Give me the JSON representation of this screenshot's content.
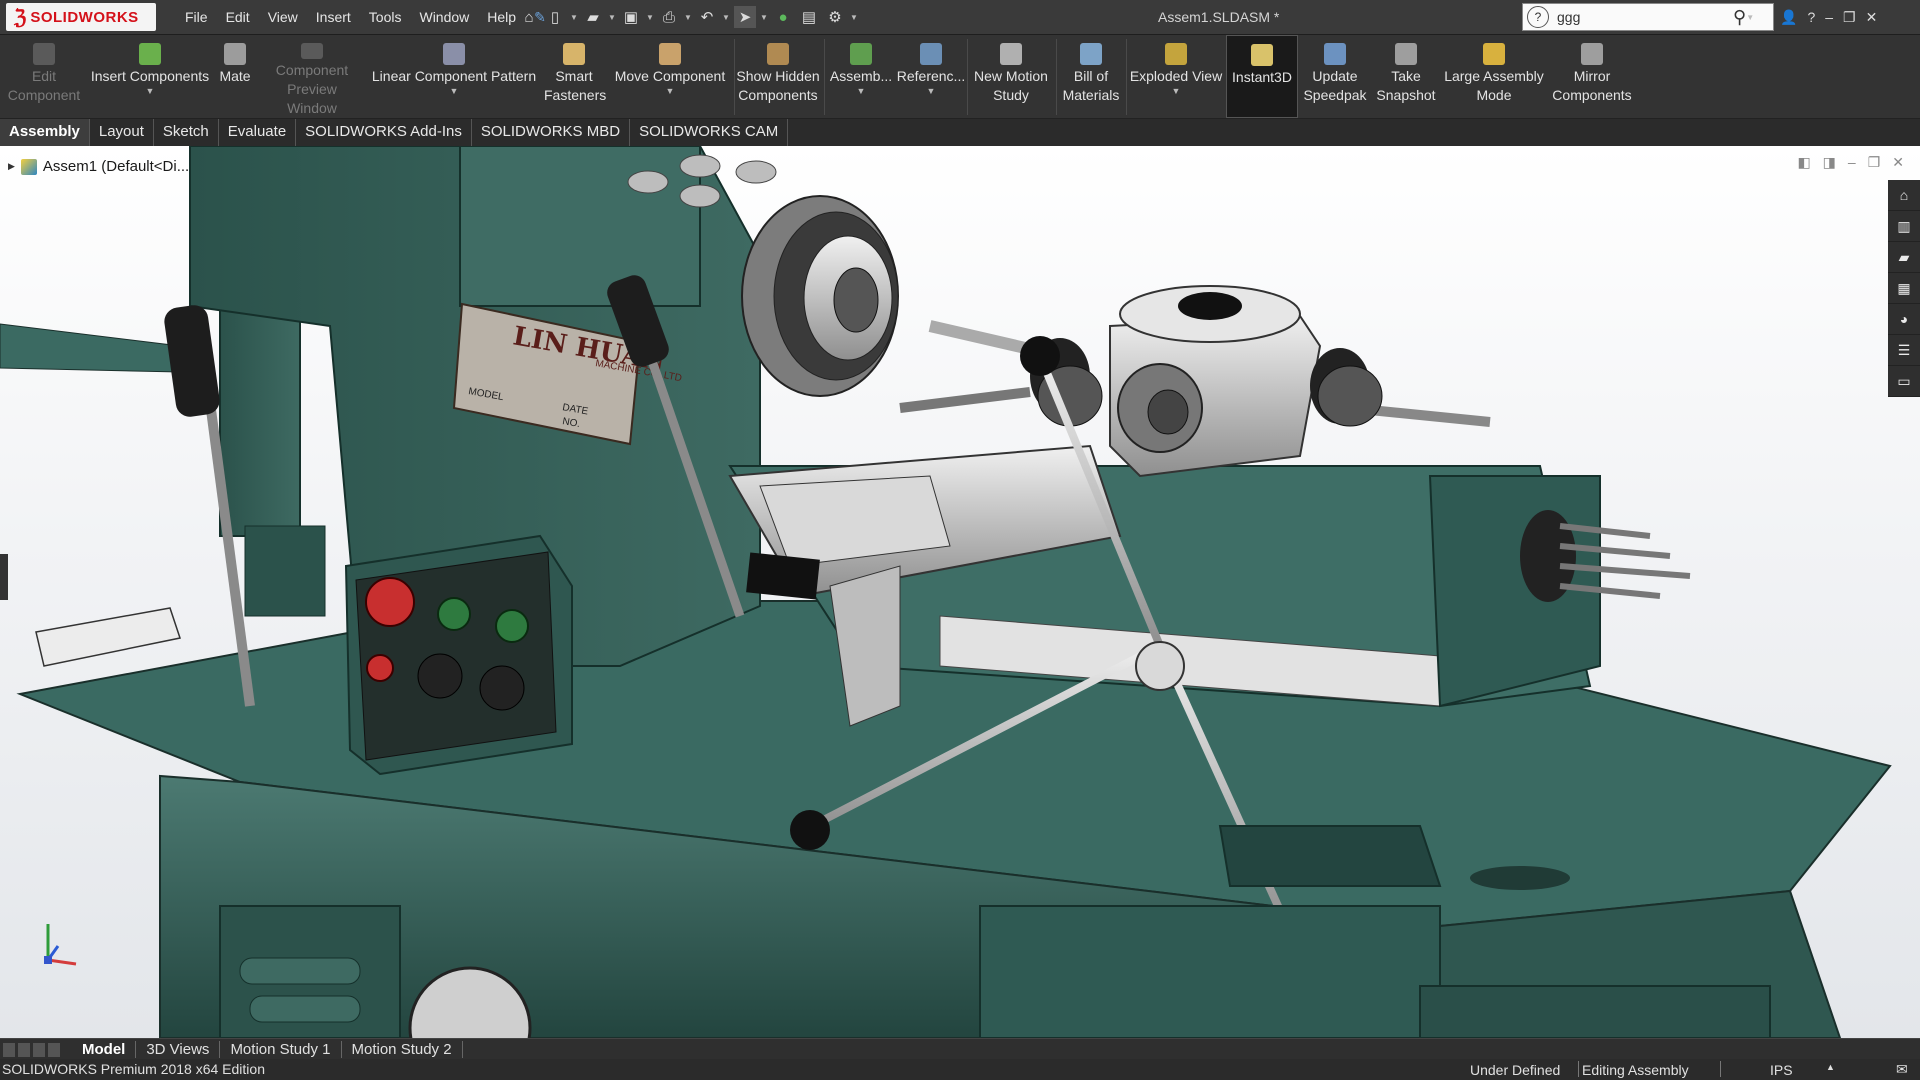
{
  "app": {
    "brand": "SOLIDWORKS",
    "document_title": "Assem1.SLDASM *"
  },
  "menu": [
    "File",
    "Edit",
    "View",
    "Insert",
    "Tools",
    "Window",
    "Help"
  ],
  "search": {
    "value": "ggg"
  },
  "command_manager": {
    "edit_component": "Edit Component",
    "insert_components": "Insert Components",
    "mate": "Mate",
    "component_preview": "Component Preview Window",
    "linear_pattern": "Linear Component Pattern",
    "smart_fasteners": "Smart Fasteners",
    "move_component": "Move Component",
    "show_hidden": "Show Hidden Components",
    "assembly_features": "Assemb...",
    "reference_geometry": "Referenc...",
    "new_motion_study": "New Motion Study",
    "bill_of_materials": "Bill of Materials",
    "exploded_view": "Exploded View",
    "instant3d": "Instant3D",
    "update_speedpak": "Update Speedpak",
    "take_snapshot": "Take Snapshot",
    "large_assembly": "Large Assembly Mode",
    "mirror_components": "Mirror Components"
  },
  "tabs": [
    "Assembly",
    "Layout",
    "Sketch",
    "Evaluate",
    "SOLIDWORKS Add-Ins",
    "SOLIDWORKS MBD",
    "SOLIDWORKS CAM"
  ],
  "tree": {
    "root": "Assem1  (Default<Di..."
  },
  "model": {
    "nameplate_brand": "LIN HUAN",
    "nameplate_sub": "MACHINE CO.,LTD",
    "nameplate_model": "MODEL",
    "nameplate_date": "DATE",
    "nameplate_no": "NO."
  },
  "bottom_tabs": [
    "Model",
    "3D Views",
    "Motion Study 1",
    "Motion Study 2"
  ],
  "status": {
    "edition": "SOLIDWORKS Premium 2018 x64 Edition",
    "state": "Under Defined",
    "mode": "Editing Assembly",
    "units": "IPS"
  },
  "colors": {
    "machine_green": "#2f5f58",
    "accent_red": "#d4111a",
    "viewport_bg": "#f3f4f6"
  }
}
